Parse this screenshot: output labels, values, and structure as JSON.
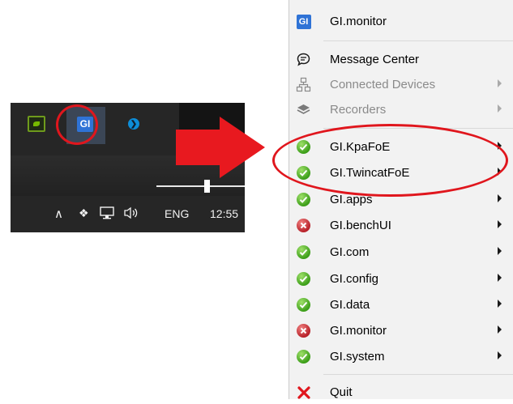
{
  "taskbar": {
    "tray_icons": [
      {
        "name": "nvidia-icon",
        "glyph": ""
      },
      {
        "name": "gi-icon",
        "glyph": "GI"
      },
      {
        "name": "bluetooth-icon",
        "glyph": "❯"
      }
    ],
    "systray": {
      "chevron_glyph": "∧",
      "dropbox_glyph": "❖",
      "network_glyph": "🖵",
      "volume_glyph": "🔈",
      "language": "ENG",
      "time": "12:55"
    }
  },
  "menu": {
    "header": {
      "label": "GI.monitor",
      "icon": "gi-app-icon"
    },
    "items": [
      {
        "label": "Message Center",
        "icon": "chat-bubble-icon",
        "enabled": true,
        "submenu": false
      },
      {
        "label": "Connected Devices",
        "icon": "network-devices-icon",
        "enabled": false,
        "submenu": true
      },
      {
        "label": "Recorders",
        "icon": "layers-icon",
        "enabled": false,
        "submenu": true
      }
    ],
    "services": [
      {
        "label": "GI.KpaFoE",
        "status": "ok"
      },
      {
        "label": "GI.TwincatFoE",
        "status": "ok"
      },
      {
        "label": "GI.apps",
        "status": "ok"
      },
      {
        "label": "GI.benchUI",
        "status": "error"
      },
      {
        "label": "GI.com",
        "status": "ok"
      },
      {
        "label": "GI.config",
        "status": "ok"
      },
      {
        "label": "GI.data",
        "status": "ok"
      },
      {
        "label": "GI.monitor",
        "status": "error"
      },
      {
        "label": "GI.system",
        "status": "ok"
      }
    ],
    "quit_label": "Quit"
  },
  "colors": {
    "annotation_red": "#e0161d",
    "gi_blue": "#2f73d6",
    "status_ok": "#3c9e19",
    "status_error": "#b8222a"
  }
}
